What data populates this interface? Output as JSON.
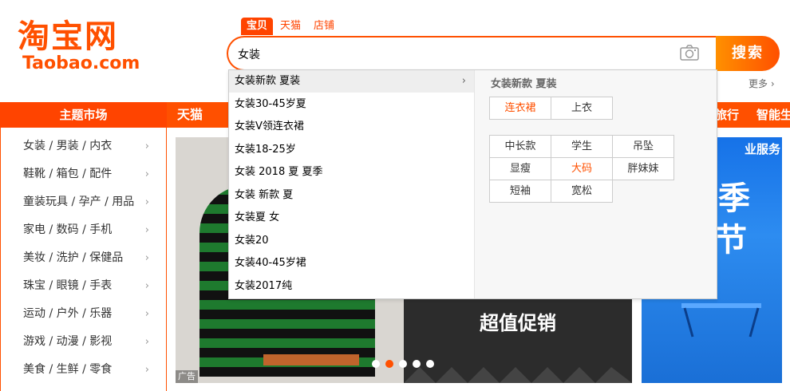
{
  "logo": {
    "cn": "淘宝网",
    "en": "Taobao.com"
  },
  "search": {
    "tabs": [
      "宝贝",
      "天猫",
      "店铺"
    ],
    "query": "女装",
    "button": "搜索",
    "camera_icon": "camera-icon"
  },
  "more": "更多",
  "nav": {
    "theme": "主题市场",
    "tmall": "天猫",
    "travel": "旅行",
    "smart": "智能生"
  },
  "categories": [
    "女装 / 男装 / 内衣",
    "鞋靴 / 箱包 / 配件",
    "童装玩具 / 孕产 / 用品",
    "家电 / 数码 / 手机",
    "美妆 / 洗护 / 保健品",
    "珠宝 / 眼镜 / 手表",
    "运动 / 户外 / 乐器",
    "游戏 / 动漫 / 影视",
    "美食 / 生鲜 / 零食"
  ],
  "suggestions": [
    "女装新款 夏装",
    "女装30-45岁夏",
    "女装V领连衣裙",
    "女装18-25岁",
    "女装 2018 夏 夏季",
    "女装 新款 夏",
    "女装夏 女",
    "女装20",
    "女装40-45岁裙",
    "女装2017纯"
  ],
  "panel": {
    "title": "女装新款 夏装",
    "group1": [
      "连衣裙",
      "上衣"
    ],
    "group2": [
      "中长款",
      "学生",
      "吊坠",
      "显瘦",
      "大码",
      "胖妹妹",
      "短袖",
      "宽松"
    ]
  },
  "banners": {
    "ad_tag": "广告",
    "promo": "超值促销",
    "right_top": "业服务",
    "right_big1": "季",
    "right_big2": "节"
  },
  "carousel": {
    "count": 5,
    "active_index": 1
  },
  "colors": {
    "brand": "#ff5000",
    "highlight": "#eeeeee"
  }
}
